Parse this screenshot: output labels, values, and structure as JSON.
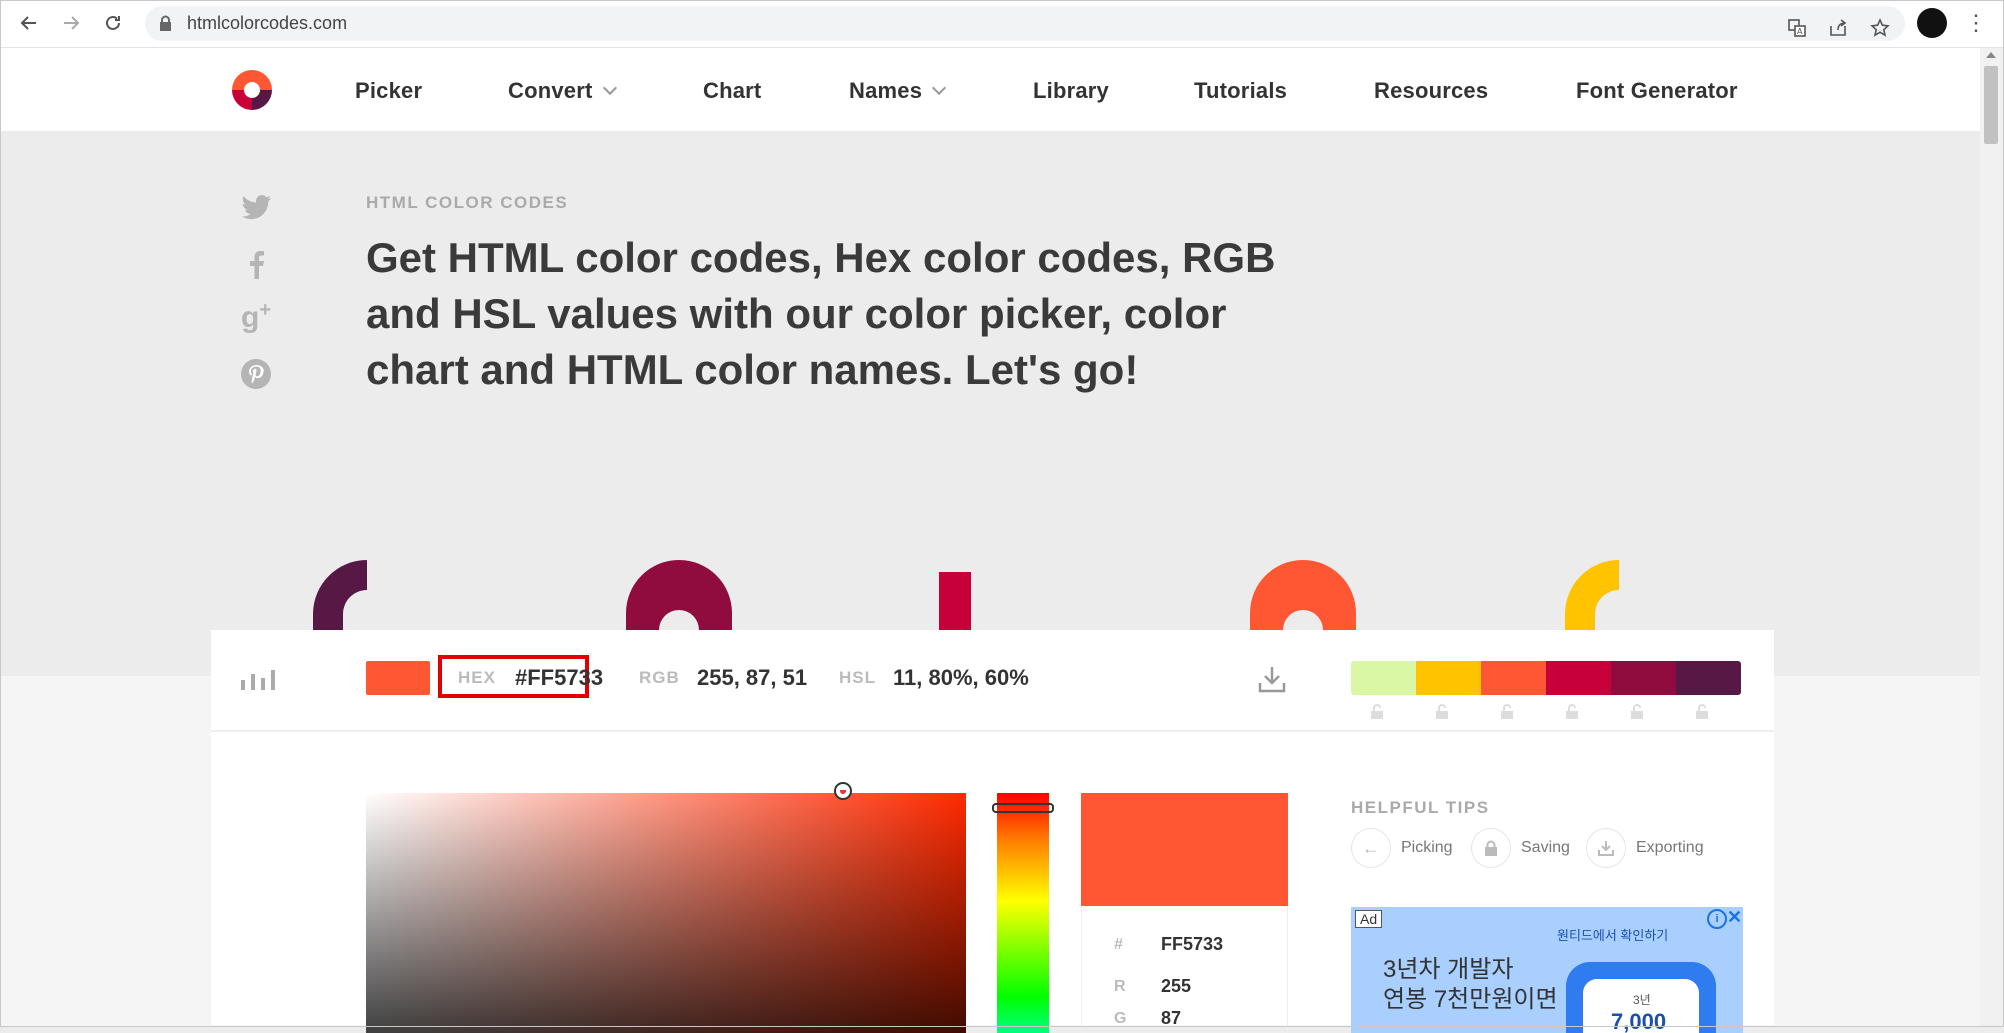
{
  "browser": {
    "url": "htmlcolorcodes.com",
    "icons": [
      "back-arrow-icon",
      "forward-arrow-icon",
      "reload-icon",
      "lock-icon",
      "translate-icon",
      "share-icon",
      "bookmark-star-icon",
      "profile-avatar",
      "kebab-menu-icon"
    ]
  },
  "nav": {
    "items": [
      {
        "label": "Picker"
      },
      {
        "label": "Convert"
      },
      {
        "label": "Chart"
      },
      {
        "label": "Names"
      },
      {
        "label": "Library"
      },
      {
        "label": "Tutorials"
      },
      {
        "label": "Resources"
      },
      {
        "label": "Font Generator"
      }
    ]
  },
  "hero": {
    "kicker": "HTML COLOR CODES",
    "headline": "Get HTML color codes, Hex color codes, RGB and HSL values with our color picker, color chart and HTML color names. Let's go!",
    "social": [
      "twitter-icon",
      "facebook-icon",
      "google-plus-icon",
      "pinterest-icon"
    ]
  },
  "colors": {
    "current": "#FF5733",
    "palette": [
      "#DAF7A6",
      "#FFC300",
      "#FF5733",
      "#C70039",
      "#900C3F",
      "#581845"
    ]
  },
  "picker": {
    "hex_label": "HEX",
    "hex_value": "#FF5733",
    "rgb_label": "RGB",
    "rgb_value": "255, 87, 51",
    "hsl_label": "HSL",
    "hsl_value": "11, 80%, 60%",
    "panel": {
      "hash_label": "#",
      "hash_value": "FF5733",
      "r_label": "R",
      "r_value": "255",
      "g_label": "G",
      "g_value": "87"
    }
  },
  "tips": {
    "title": "HELPFUL TIPS",
    "items": [
      {
        "label": "Picking"
      },
      {
        "label": "Saving"
      },
      {
        "label": "Exporting"
      }
    ]
  },
  "ad": {
    "tag": "Ad",
    "small": "원티드에서 확인하기",
    "line1": "3년차 개발자",
    "line2": "연봉 7천만원이면",
    "phone_top": "3년",
    "phone_bottom": "7,000"
  }
}
